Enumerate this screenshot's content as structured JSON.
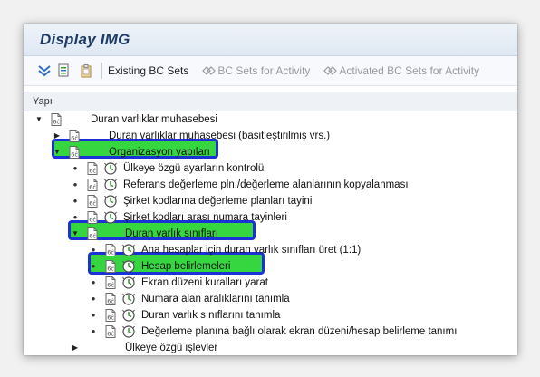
{
  "title": "Display IMG",
  "toolbar": {
    "existing_bc_sets": "Existing BC Sets",
    "bc_sets_for_activity": "BC Sets for Activity",
    "activated_bc_sets_for_activity": "Activated BC Sets for Activity"
  },
  "tree_header": "Yapı",
  "tree": {
    "root": "Duran varlıklar muhasebesi",
    "simplified": "Duran varlıklar muhasebesi (basitleştirilmiş vrs.)",
    "org": "Organizasyon yapıları",
    "org_items": [
      "Ülkeye özgü ayarların kontrolü",
      "Referans değerleme pln./değerleme alanlarının kopyalanması",
      "Şirket kodlarına değerleme planları tayini",
      "Şirket kodları arası numara tayinleri"
    ],
    "asset_classes": "Duran varlık sınıfları",
    "class_items": [
      "Ana hesaplar için duran varlık sınıfları üret (1:1)",
      "Hesap belirlemeleri",
      "Ekran düzeni kuralları yarat",
      "Numara alan aralıklarını tanımla",
      "Duran varlık sınıflarını tanımla",
      "Değerleme planına bağlı olarak ekran düzeni/hesap belirleme tanımı"
    ],
    "country_functions": "Ülkeye özgü işlevler"
  },
  "colors": {
    "highlight_fill": "#36d640",
    "highlight_border": "#1b33d6",
    "title_text": "#1d3b64"
  }
}
